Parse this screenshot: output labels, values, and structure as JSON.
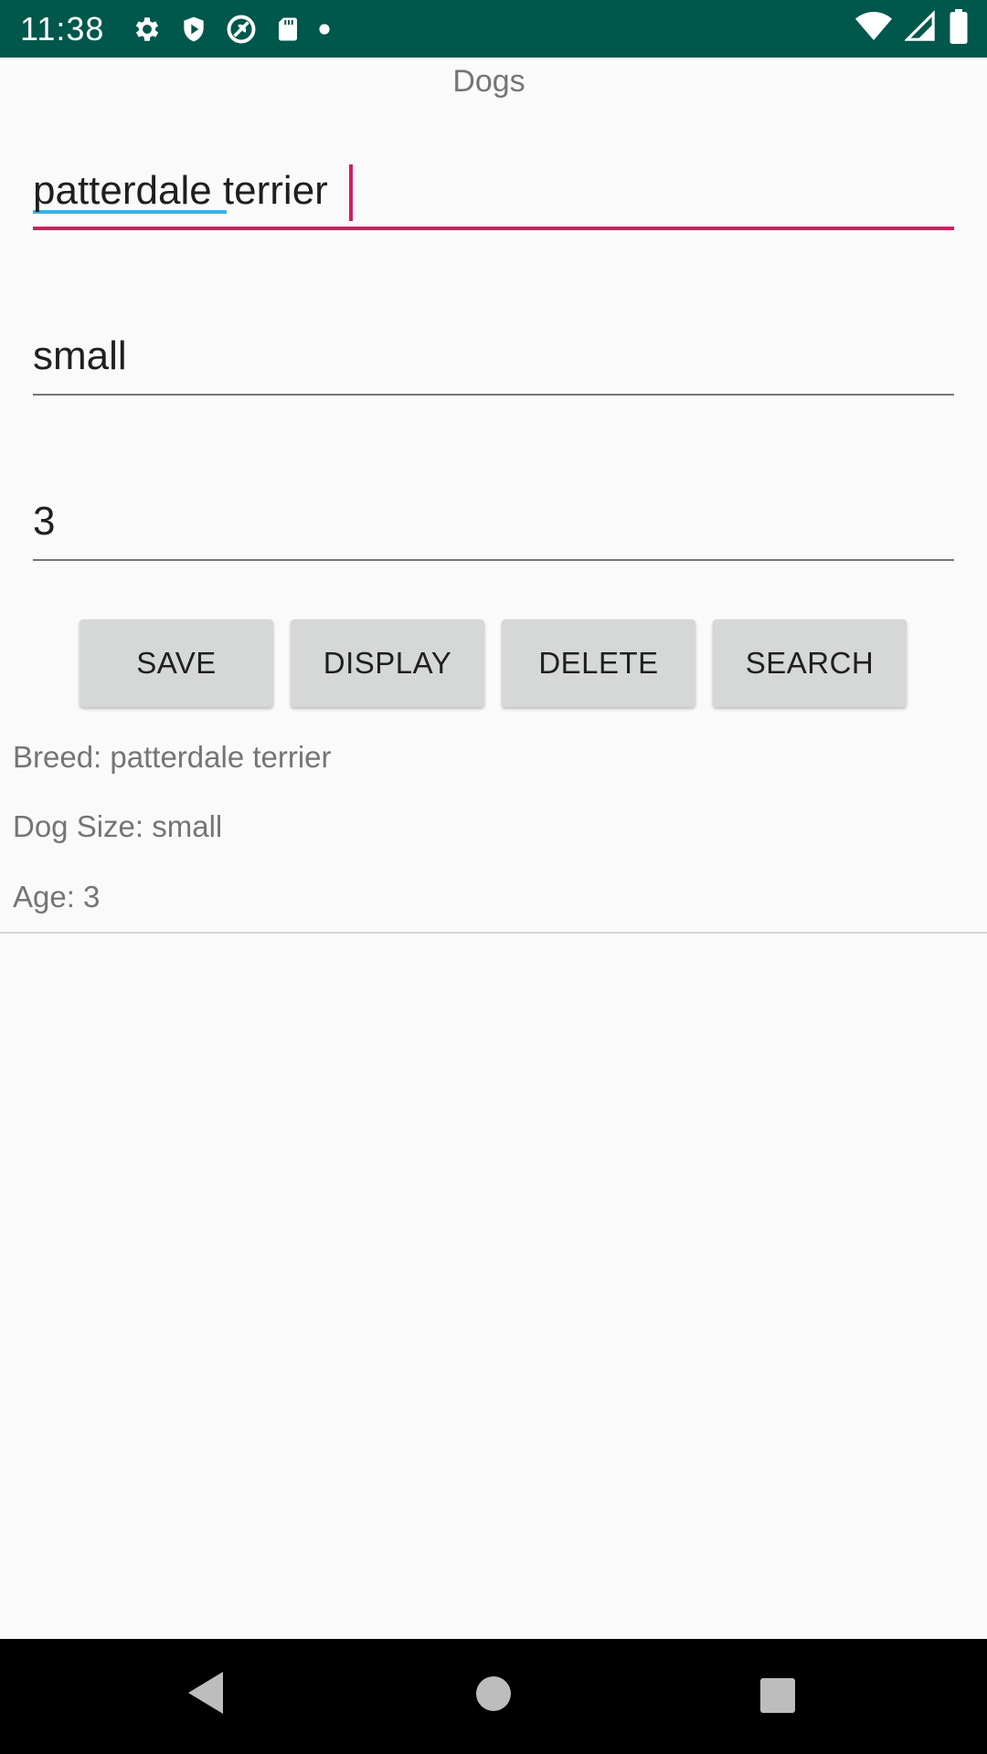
{
  "status_bar": {
    "time": "11:38",
    "icons_left": [
      "gear-icon",
      "shield-play-icon",
      "vpn-icon",
      "sd-card-icon",
      "notification-dot-icon"
    ],
    "icons_right": [
      "wifi-icon",
      "cellular-signal-icon",
      "battery-icon"
    ],
    "background": "#00574b"
  },
  "app": {
    "title": "Dogs"
  },
  "form": {
    "breed_value": "patterdale terrier",
    "size_value": "small",
    "age_value": "3",
    "accent_color": "#d81b60"
  },
  "buttons": {
    "save": "SAVE",
    "display": "DISPLAY",
    "delete": "DELETE",
    "search": "SEARCH"
  },
  "results": {
    "breed": "Breed: patterdale terrier",
    "size": "Dog Size: small",
    "age": "Age: 3"
  },
  "nav_bar": {
    "icons": [
      "back-icon",
      "home-icon",
      "recents-icon"
    ]
  }
}
